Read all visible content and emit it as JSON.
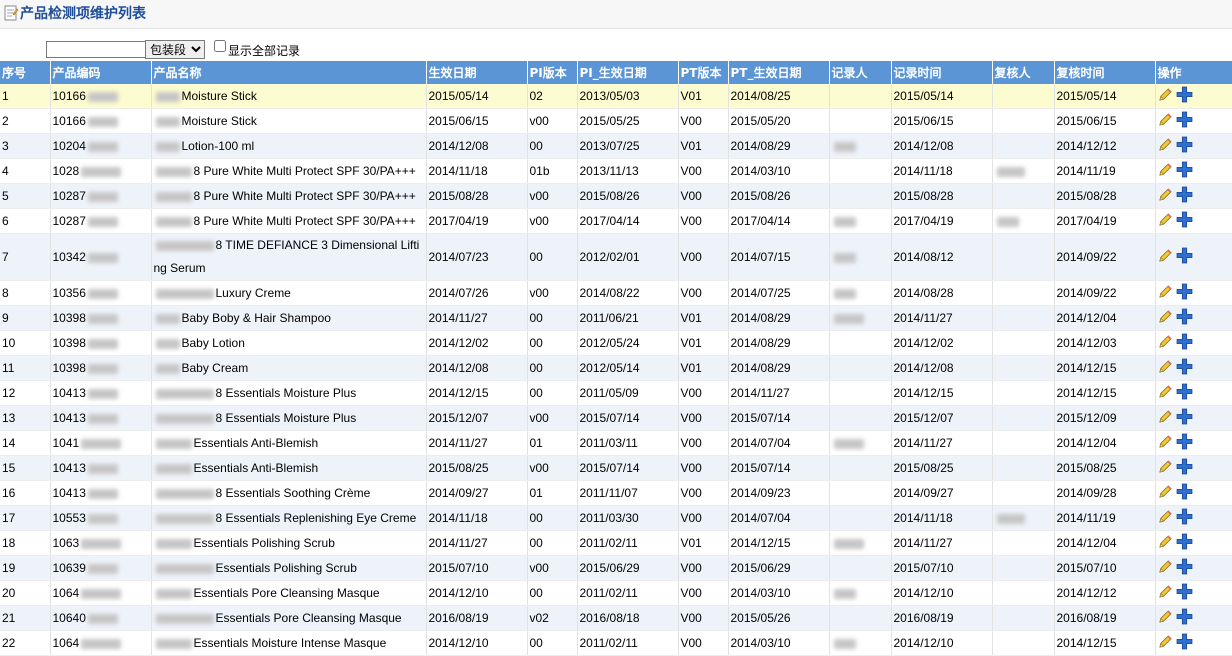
{
  "header": {
    "title": "产品检测项维护列表"
  },
  "filter": {
    "search_value": "",
    "select_value": "包装段",
    "checkbox_label": "显示全部记录"
  },
  "columns": [
    "序号",
    "产品编码",
    "产品名称",
    "生效日期",
    "PI版本",
    "PI_生效日期",
    "PT版本",
    "PT_生效日期",
    "记录人",
    "记录时间",
    "复核人",
    "复核时间",
    "操作"
  ],
  "rows": [
    {
      "no": "1",
      "code": "10166",
      "name": "Moisture Stick",
      "eff": "2015/05/14",
      "pi": "02",
      "pi_date": "2013/05/03",
      "pt": "V01",
      "pt_date": "2014/08/25",
      "rec_time": "2015/05/14",
      "rev_time": "2015/05/14"
    },
    {
      "no": "2",
      "code": "10166",
      "name": "Moisture Stick",
      "eff": "2015/06/15",
      "pi": "v00",
      "pi_date": "2015/05/25",
      "pt": "V00",
      "pt_date": "2015/05/20",
      "rec_time": "2015/06/15",
      "rev_time": "2015/06/15"
    },
    {
      "no": "3",
      "code": "10204",
      "name": "Lotion-100 ml",
      "eff": "2014/12/08",
      "pi": "00",
      "pi_date": "2013/07/25",
      "pt": "V01",
      "pt_date": "2014/08/29",
      "rec_time": "2014/12/08",
      "rev_time": "2014/12/12"
    },
    {
      "no": "4",
      "code": "1028",
      "name": "8 Pure White Multi Protect SPF 30/PA+++",
      "eff": "2014/11/18",
      "pi": "01b",
      "pi_date": "2013/11/13",
      "pt": "V00",
      "pt_date": "2014/03/10",
      "rec_time": "2014/11/18",
      "rev_time": "2014/11/19"
    },
    {
      "no": "5",
      "code": "10287",
      "name": "8 Pure White Multi Protect SPF 30/PA+++",
      "eff": "2015/08/28",
      "pi": "v00",
      "pi_date": "2015/08/26",
      "pt": "V00",
      "pt_date": "2015/08/26",
      "rec_time": "2015/08/28",
      "rev_time": "2015/08/28"
    },
    {
      "no": "6",
      "code": "10287",
      "name": "8 Pure White Multi Protect SPF 30/PA+++",
      "eff": "2017/04/19",
      "pi": "v00",
      "pi_date": "2017/04/14",
      "pt": "V00",
      "pt_date": "2017/04/14",
      "rec_time": "2017/04/19",
      "rev_time": "2017/04/19"
    },
    {
      "no": "7",
      "code": "10342",
      "name": "8 TIME DEFIANCE 3 Dimensional Lifting Serum",
      "eff": "2014/07/23",
      "pi": "00",
      "pi_date": "2012/02/01",
      "pt": "V00",
      "pt_date": "2014/07/15",
      "rec_time": "2014/08/12",
      "rev_time": "2014/09/22"
    },
    {
      "no": "8",
      "code": "10356",
      "name": "Luxury Creme",
      "eff": "2014/07/26",
      "pi": "v00",
      "pi_date": "2014/08/22",
      "pt": "V00",
      "pt_date": "2014/07/25",
      "rec_time": "2014/08/28",
      "rev_time": "2014/09/22"
    },
    {
      "no": "9",
      "code": "10398",
      "name": "Baby Boby & Hair Shampoo",
      "eff": "2014/11/27",
      "pi": "00",
      "pi_date": "2011/06/21",
      "pt": "V01",
      "pt_date": "2014/08/29",
      "rec_time": "2014/11/27",
      "rev_time": "2014/12/04"
    },
    {
      "no": "10",
      "code": "10398",
      "name": "Baby Lotion",
      "eff": "2014/12/02",
      "pi": "00",
      "pi_date": "2012/05/24",
      "pt": "V01",
      "pt_date": "2014/08/29",
      "rec_time": "2014/12/02",
      "rev_time": "2014/12/03"
    },
    {
      "no": "11",
      "code": "10398",
      "name": "Baby Cream",
      "eff": "2014/12/08",
      "pi": "00",
      "pi_date": "2012/05/14",
      "pt": "V01",
      "pt_date": "2014/08/29",
      "rec_time": "2014/12/08",
      "rev_time": "2014/12/15"
    },
    {
      "no": "12",
      "code": "10413",
      "name": "8 Essentials Moisture Plus",
      "eff": "2014/12/15",
      "pi": "00",
      "pi_date": "2011/05/09",
      "pt": "V00",
      "pt_date": "2014/11/27",
      "rec_time": "2014/12/15",
      "rev_time": "2014/12/15"
    },
    {
      "no": "13",
      "code": "10413",
      "name": "8 Essentials Moisture Plus",
      "eff": "2015/12/07",
      "pi": "v00",
      "pi_date": "2015/07/14",
      "pt": "V00",
      "pt_date": "2015/07/14",
      "rec_time": "2015/12/07",
      "rev_time": "2015/12/09"
    },
    {
      "no": "14",
      "code": "1041",
      "name": "Essentials Anti-Blemish",
      "eff": "2014/11/27",
      "pi": "01",
      "pi_date": "2011/03/11",
      "pt": "V00",
      "pt_date": "2014/07/04",
      "rec_time": "2014/11/27",
      "rev_time": "2014/12/04"
    },
    {
      "no": "15",
      "code": "10413",
      "name": "Essentials Anti-Blemish",
      "eff": "2015/08/25",
      "pi": "v00",
      "pi_date": "2015/07/14",
      "pt": "V00",
      "pt_date": "2015/07/14",
      "rec_time": "2015/08/25",
      "rev_time": "2015/08/25"
    },
    {
      "no": "16",
      "code": "10413",
      "name": "8 Essentials Soothing Crème",
      "eff": "2014/09/27",
      "pi": "01",
      "pi_date": "2011/11/07",
      "pt": "V00",
      "pt_date": "2014/09/23",
      "rec_time": "2014/09/27",
      "rev_time": "2014/09/28"
    },
    {
      "no": "17",
      "code": "10553",
      "name": "8 Essentials Replenishing Eye Creme",
      "eff": "2014/11/18",
      "pi": "00",
      "pi_date": "2011/03/30",
      "pt": "V00",
      "pt_date": "2014/07/04",
      "rec_time": "2014/11/18",
      "rev_time": "2014/11/19"
    },
    {
      "no": "18",
      "code": "1063",
      "name": "Essentials Polishing Scrub",
      "eff": "2014/11/27",
      "pi": "00",
      "pi_date": "2011/02/11",
      "pt": "V01",
      "pt_date": "2014/12/15",
      "rec_time": "2014/11/27",
      "rev_time": "2014/12/04"
    },
    {
      "no": "19",
      "code": "10639",
      "name": "Essentials Polishing Scrub",
      "eff": "2015/07/10",
      "pi": "v00",
      "pi_date": "2015/06/29",
      "pt": "V00",
      "pt_date": "2015/06/29",
      "rec_time": "2015/07/10",
      "rev_time": "2015/07/10"
    },
    {
      "no": "20",
      "code": "1064",
      "name": "Essentials Pore Cleansing Masque",
      "eff": "2014/12/10",
      "pi": "00",
      "pi_date": "2011/02/11",
      "pt": "V00",
      "pt_date": "2014/03/10",
      "rec_time": "2014/12/10",
      "rev_time": "2014/12/12"
    },
    {
      "no": "21",
      "code": "10640",
      "name": "Essentials Pore Cleansing Masque",
      "eff": "2016/08/19",
      "pi": "v02",
      "pi_date": "2016/08/18",
      "pt": "V00",
      "pt_date": "2015/05/26",
      "rec_time": "2016/08/19",
      "rev_time": "2016/08/19"
    },
    {
      "no": "22",
      "code": "1064",
      "name": "Essentials Moisture Intense Masque",
      "eff": "2014/12/10",
      "pi": "00",
      "pi_date": "2011/02/11",
      "pt": "V00",
      "pt_date": "2014/03/10",
      "rec_time": "2014/12/10",
      "rev_time": "2014/12/15"
    }
  ],
  "colors": {
    "header_bg": "#5b95d6",
    "selected_row": "#fdfbd0",
    "alt_row": "#eef3fa",
    "title": "#1f4e9a"
  },
  "icons": {
    "title": "document-icon",
    "edit": "pencil-icon",
    "add": "plus-icon"
  }
}
